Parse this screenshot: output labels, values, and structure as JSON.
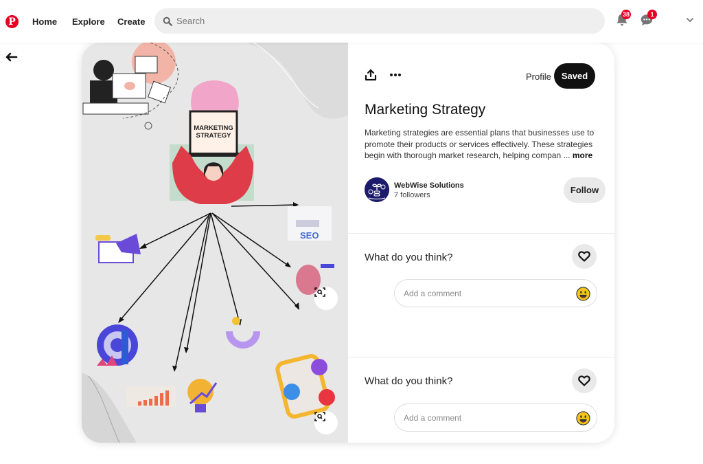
{
  "nav": {
    "logo_glyph": "P",
    "links": [
      "Home",
      "Explore",
      "Create"
    ],
    "search_placeholder": "Search",
    "notifications_count": "38",
    "messages_count": "1",
    "brand_color": "#e60023"
  },
  "pin": {
    "image_title_text": [
      "MARKETING",
      "STRATEGY"
    ],
    "image_seo_text": "SEO",
    "profile_label": "Profile",
    "saved_label": "Saved",
    "title": "Marketing Strategy",
    "description": "Marketing strategies are essential plans that businesses use to promote their products or services effectively. These strategies begin with thorough market research, helping compan ...",
    "more_label": "more",
    "creator": {
      "name": "WebWise Solutions",
      "followers": "7 followers",
      "follow_label": "Follow"
    }
  },
  "comments": [
    {
      "title": "What do you think?",
      "placeholder": "Add a comment"
    },
    {
      "title": "What do you think?",
      "placeholder": "Add a comment"
    }
  ],
  "icons": {
    "logo": "pinterest-logo-icon",
    "search": "search-icon",
    "bell": "bell-icon",
    "chat": "chat-icon",
    "chevron": "chevron-down-icon",
    "back": "arrow-left-icon",
    "share": "share-icon",
    "more": "ellipsis-icon",
    "heart": "heart-icon",
    "emoji": "emoji-icon",
    "lens": "visual-search-icon"
  }
}
